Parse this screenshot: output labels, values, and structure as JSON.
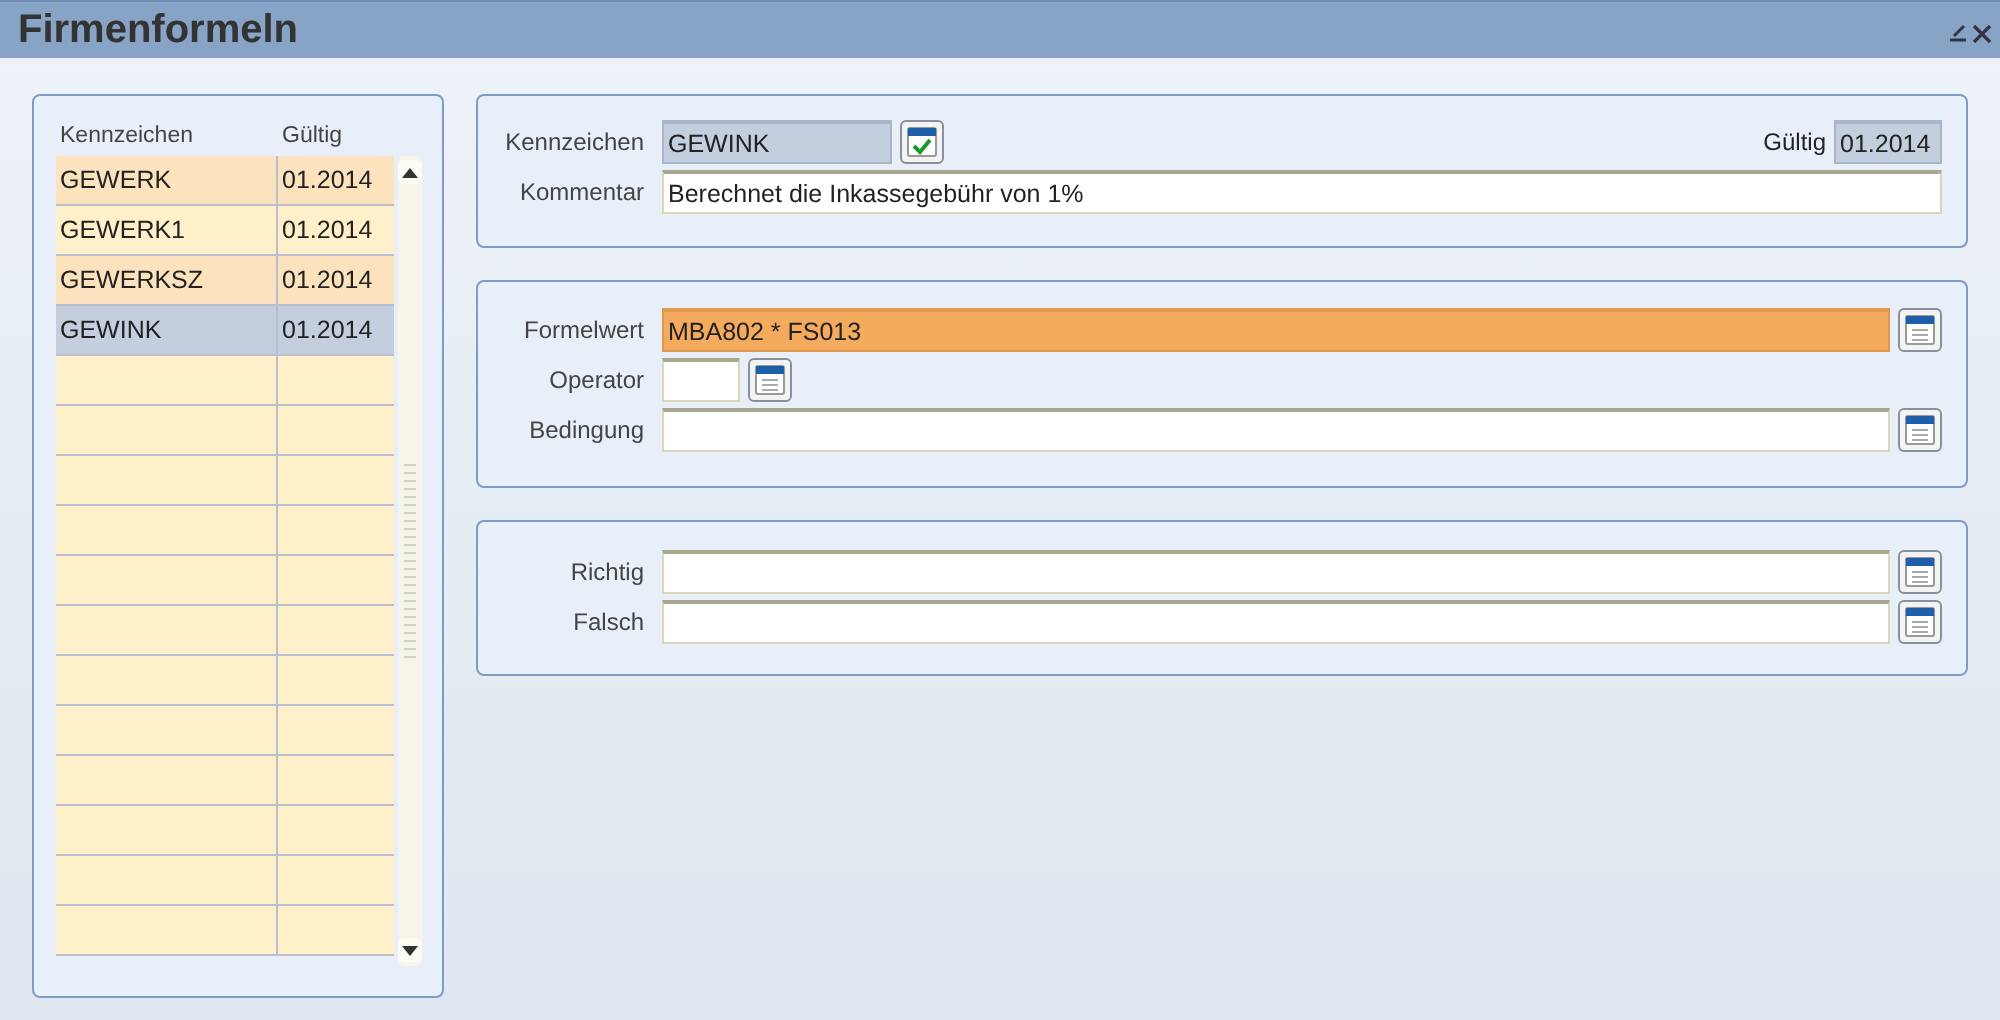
{
  "window": {
    "title": "Firmenformeln"
  },
  "list": {
    "columns": [
      "Kennzeichen",
      "Gültig"
    ],
    "rows": [
      {
        "kennzeichen": "GEWERK",
        "gueltig": "01.2014",
        "selected": false
      },
      {
        "kennzeichen": "GEWERK1",
        "gueltig": "01.2014",
        "selected": false
      },
      {
        "kennzeichen": "GEWERKSZ",
        "gueltig": "01.2014",
        "selected": false
      },
      {
        "kennzeichen": "GEWINK",
        "gueltig": "01.2014",
        "selected": true
      }
    ]
  },
  "header": {
    "kennzeichen": {
      "label": "Kennzeichen",
      "value": "GEWINK",
      "readonly": true
    },
    "gueltig": {
      "label": "Gültig",
      "value": "01.2014",
      "readonly": true
    },
    "kommentar": {
      "label": "Kommentar",
      "value": "Berechnet die Inkassegebühr von 1%",
      "readonly": false
    }
  },
  "sections": [
    [
      {
        "label": "Formelwert",
        "value": "MBA802 * FS013",
        "highlighted": true,
        "kind": "wide"
      },
      {
        "label": "Operator",
        "highlighted": false,
        "kind": "short"
      },
      {
        "label": "Bedingung",
        "highlighted": false,
        "kind": "wide"
      }
    ],
    [
      {
        "label": "Richtig",
        "highlighted": false,
        "kind": "wide"
      },
      {
        "label": "Falsch",
        "highlighted": false,
        "kind": "wide"
      }
    ]
  ]
}
